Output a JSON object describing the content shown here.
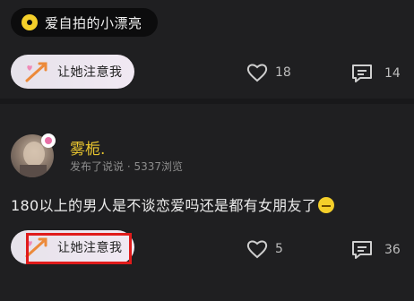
{
  "top_tag": {
    "text": "爱自拍的小漂亮",
    "icon": "tag-dot-icon"
  },
  "post1": {
    "attention_label": "让她注意我",
    "likes": "18",
    "comments": "14"
  },
  "post2": {
    "user_name": "雾栀.",
    "meta": "发布了说说 · 5337浏览",
    "content": "180以上的男人是不谈恋爱吗还是都有女朋友了",
    "emoji": "neutral-face-emoji",
    "attention_label": "让她注意我",
    "likes": "5",
    "comments": "36"
  },
  "colors": {
    "background": "#1f1f21",
    "accent_yellow": "#f4cf2a",
    "highlight": "#e01b1b"
  }
}
